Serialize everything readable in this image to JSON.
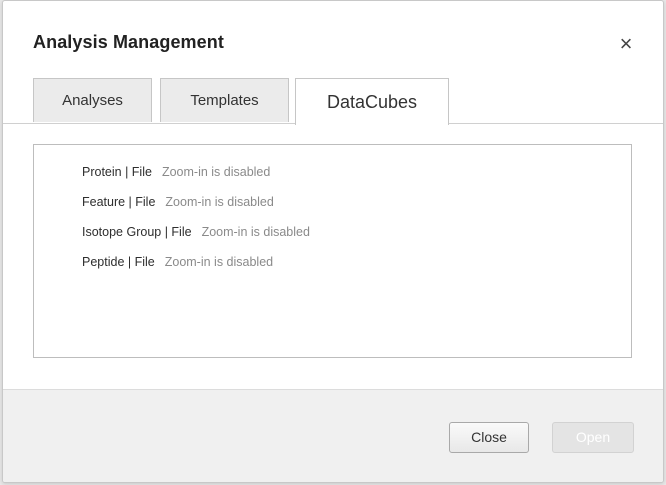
{
  "dialog": {
    "title": "Analysis Management",
    "close_glyph": "×"
  },
  "tabs": [
    {
      "label": "Analyses",
      "active": false
    },
    {
      "label": "Templates",
      "active": false
    },
    {
      "label": "DataCubes",
      "active": true
    }
  ],
  "datacubes": [
    {
      "name": "Protein | File",
      "note": "Zoom-in is disabled"
    },
    {
      "name": "Feature | File",
      "note": "Zoom-in is disabled"
    },
    {
      "name": "Isotope Group | File",
      "note": "Zoom-in is disabled"
    },
    {
      "name": "Peptide | File",
      "note": "Zoom-in is disabled"
    }
  ],
  "footer": {
    "close_label": "Close",
    "open_label": "Open",
    "open_enabled": false
  }
}
